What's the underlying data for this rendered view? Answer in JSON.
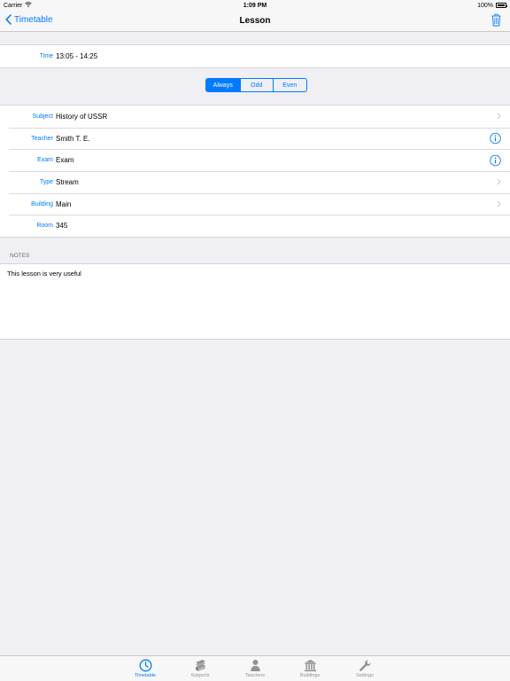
{
  "status_bar": {
    "carrier": "Carrier",
    "time": "1:09 PM",
    "battery": "100%"
  },
  "nav": {
    "back_label": "Timetable",
    "title": "Lesson"
  },
  "time_row": {
    "label": "Time",
    "value": "13:05 - 14:25"
  },
  "segmented": {
    "options": [
      "Always",
      "Odd",
      "Even"
    ],
    "selected": "Always"
  },
  "details": [
    {
      "label": "Subject",
      "value": "History of USSR",
      "accessory": "chevron-right-icon"
    },
    {
      "label": "Teacher",
      "value": "Smith T. E.",
      "accessory": "info-icon"
    },
    {
      "label": "Exam",
      "value": "Exam",
      "accessory": "info-icon"
    },
    {
      "label": "Type",
      "value": "Stream",
      "accessory": "chevron-right-icon"
    },
    {
      "label": "Building",
      "value": "Main",
      "accessory": "chevron-right-icon"
    },
    {
      "label": "Room",
      "value": "345",
      "accessory": ""
    }
  ],
  "notes": {
    "header": "NOTES",
    "text": "This lesson is very useful"
  },
  "tabs": [
    {
      "label": "Timetable",
      "icon": "clock-icon",
      "active": true
    },
    {
      "label": "Subjects",
      "icon": "books-icon",
      "active": false
    },
    {
      "label": "Teachers",
      "icon": "person-icon",
      "active": false
    },
    {
      "label": "Buildings",
      "icon": "building-icon",
      "active": false
    },
    {
      "label": "Settings",
      "icon": "wrench-icon",
      "active": false
    }
  ],
  "colors": {
    "accent": "#007aff",
    "background": "#efeff4",
    "inactive": "#929292"
  }
}
